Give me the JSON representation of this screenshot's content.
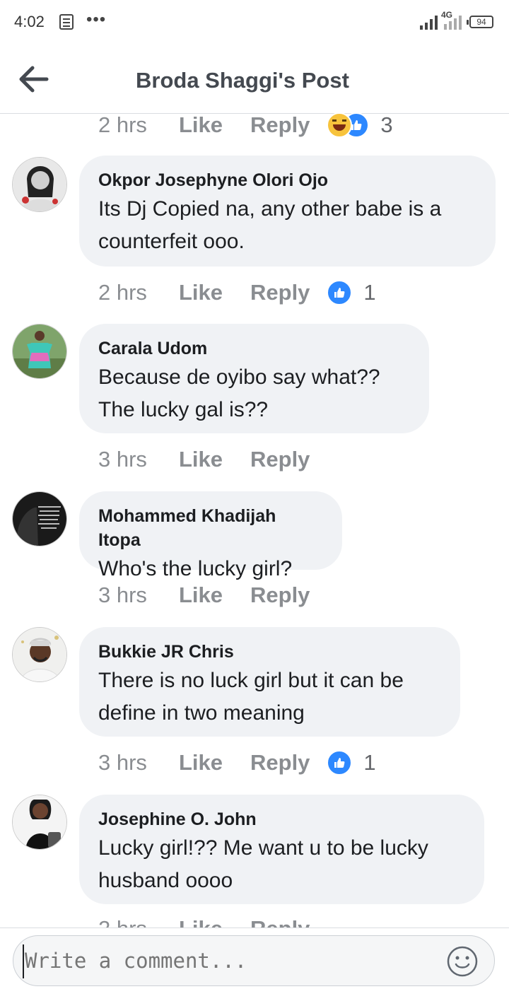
{
  "status_bar": {
    "time": "4:02",
    "network": "4G",
    "battery": "94"
  },
  "header": {
    "title": "Broda Shaggi's Post"
  },
  "top_partial": {
    "time": "2 hrs",
    "like": "Like",
    "reply": "Reply",
    "reaction_count": "3",
    "reactions": [
      "haha-icon",
      "like-icon"
    ]
  },
  "comments": [
    {
      "author": "Okpor Josephyne Olori Ojo",
      "lines": [
        "Its Dj Copied na, any other babe is a",
        "counterfeit ooo."
      ],
      "time": "2 hrs",
      "like": "Like",
      "reply": "Reply",
      "reaction_count": "1"
    },
    {
      "author": "Carala Udom",
      "lines": [
        "Because de oyibo say what??",
        "The lucky gal is??"
      ],
      "time": "3 hrs",
      "like": "Like",
      "reply": "Reply",
      "reaction_count": ""
    },
    {
      "author": "Mohammed Khadijah Itopa",
      "lines": [
        "Who's the lucky girl?"
      ],
      "time": "3 hrs",
      "like": "Like",
      "reply": "Reply",
      "reaction_count": ""
    },
    {
      "author": "Bukkie JR Chris",
      "lines": [
        "There is no luck girl but it can be",
        "define in two meaning"
      ],
      "time": "3 hrs",
      "like": "Like",
      "reply": "Reply",
      "reaction_count": "1"
    },
    {
      "author": "Josephine O. John",
      "lines": [
        "Lucky girl!?? Me want u to be lucky",
        "husband oooo"
      ],
      "time": "",
      "like": "",
      "reply": "",
      "reaction_count": ""
    }
  ],
  "composer": {
    "placeholder": "Write a comment..."
  },
  "colors": {
    "like_blue": "#2d88ff",
    "bubble_bg": "#f0f2f5",
    "meta_gray": "#8a8d91"
  }
}
